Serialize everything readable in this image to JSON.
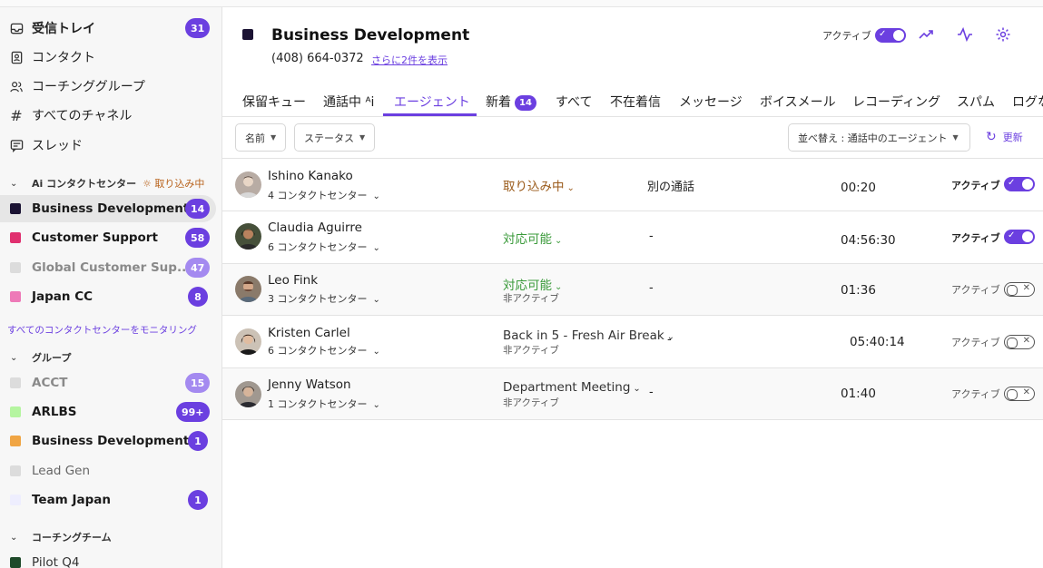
{
  "sidebar": {
    "nav": [
      {
        "label": "受信トレイ",
        "badge": "31",
        "icon": "inbox-icon"
      },
      {
        "label": "コンタクト",
        "icon": "contact-icon"
      },
      {
        "label": "コーチンググループ",
        "icon": "people-icon"
      },
      {
        "label": "すべてのチャネル",
        "icon": "hash-icon"
      },
      {
        "label": "スレッド",
        "icon": "thread-icon"
      }
    ],
    "ai_section": {
      "title": "Ai コンタクトセンター",
      "status": "取り込み中"
    },
    "contact_centers": [
      {
        "label": "Business Development",
        "badge": "14",
        "color": "#1b1333"
      },
      {
        "label": "Customer Support",
        "badge": "58",
        "color": "#e0306f"
      },
      {
        "label": "Global Customer Sup...",
        "badge": "47",
        "color": "#dcdcdc"
      },
      {
        "label": "Japan CC",
        "badge": "8",
        "color": "#ee7ab8"
      }
    ],
    "monitor_link": "すべてのコンタクトセンターをモニタリング",
    "group_section": {
      "title": "グループ"
    },
    "groups": [
      {
        "label": "ACCT",
        "badge": "15",
        "color": "#dcdcdc"
      },
      {
        "label": "ARLBS",
        "badge": "99+",
        "color": "#b5f5a0"
      },
      {
        "label": "Business Development",
        "badge": "1",
        "color": "#f0a544"
      },
      {
        "label": "Lead Gen",
        "color": "#dcdcdc"
      },
      {
        "label": "Team Japan",
        "badge": "1",
        "color": "#eeeefe"
      }
    ],
    "coaching_section": {
      "title": "コーチングチーム"
    },
    "coaching": [
      {
        "label": "Pilot Q4",
        "color": "#1f4a2a"
      }
    ]
  },
  "header": {
    "title": "Business Development",
    "phone": "(408) 664-0372",
    "more_link": "さらに2件を表示",
    "active_label": "アクティブ"
  },
  "tabs": [
    {
      "label": "保留キュー"
    },
    {
      "label": "通話中 ᴬi"
    },
    {
      "label": "エージェント"
    },
    {
      "label": "新着",
      "badge": "14"
    },
    {
      "label": "すべて"
    },
    {
      "label": "不在着信"
    },
    {
      "label": "メッセージ"
    },
    {
      "label": "ボイスメール"
    },
    {
      "label": "レコーディング"
    },
    {
      "label": "スパム"
    },
    {
      "label": "ログな"
    }
  ],
  "filters": {
    "name": "名前",
    "status": "ステータス",
    "sort": "並べ替え : 通話中のエージェント",
    "refresh": "更新"
  },
  "agents": [
    {
      "name": "Ishino Kanako",
      "centers": "4 コンタクトセンター",
      "status": "取り込み中",
      "sub": "",
      "call": "別の通話",
      "time": "00:20",
      "active": "アクティブ",
      "on": true
    },
    {
      "name": "Claudia Aguirre",
      "centers": "6 コンタクトセンター",
      "status": "対応可能",
      "sub": "",
      "call": "-",
      "time": "04:56:30",
      "active": "アクティブ",
      "on": true
    },
    {
      "name": "Leo Fink",
      "centers": "3 コンタクトセンター",
      "status": "対応可能",
      "sub": "非アクティブ",
      "call": "-",
      "time": "01:36",
      "active": "アクティブ",
      "on": false
    },
    {
      "name": "Kristen Carlel",
      "centers": "6 コンタクトセンター",
      "status": "Back in 5 - Fresh Air Break",
      "sub": "非アクティブ",
      "call": "-",
      "time": "05:40:14",
      "active": "アクティブ",
      "on": false
    },
    {
      "name": "Jenny Watson",
      "centers": "1 コンタクトセンター",
      "status": "Department Meeting",
      "sub": "非アクティブ",
      "call": "-",
      "time": "01:40",
      "active": "アクティブ",
      "on": false
    }
  ]
}
